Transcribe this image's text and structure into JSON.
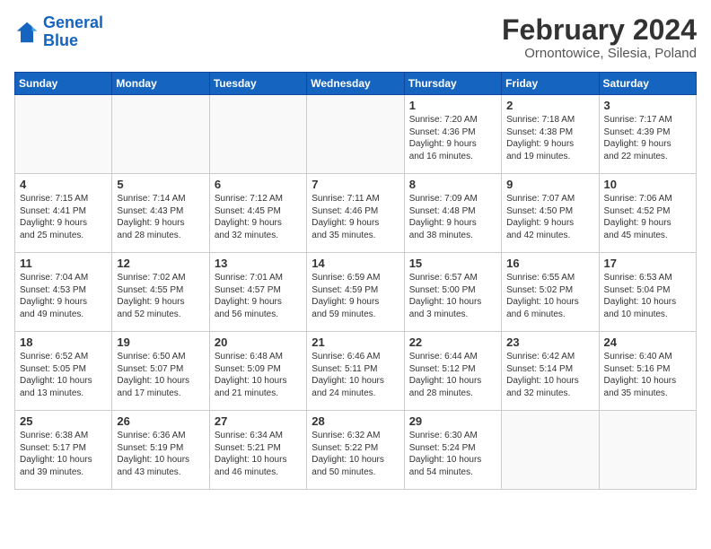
{
  "logo": {
    "line1": "General",
    "line2": "Blue"
  },
  "title": "February 2024",
  "subtitle": "Ornontowice, Silesia, Poland",
  "days_of_week": [
    "Sunday",
    "Monday",
    "Tuesday",
    "Wednesday",
    "Thursday",
    "Friday",
    "Saturday"
  ],
  "weeks": [
    [
      {
        "day": "",
        "info": ""
      },
      {
        "day": "",
        "info": ""
      },
      {
        "day": "",
        "info": ""
      },
      {
        "day": "",
        "info": ""
      },
      {
        "day": "1",
        "info": "Sunrise: 7:20 AM\nSunset: 4:36 PM\nDaylight: 9 hours\nand 16 minutes."
      },
      {
        "day": "2",
        "info": "Sunrise: 7:18 AM\nSunset: 4:38 PM\nDaylight: 9 hours\nand 19 minutes."
      },
      {
        "day": "3",
        "info": "Sunrise: 7:17 AM\nSunset: 4:39 PM\nDaylight: 9 hours\nand 22 minutes."
      }
    ],
    [
      {
        "day": "4",
        "info": "Sunrise: 7:15 AM\nSunset: 4:41 PM\nDaylight: 9 hours\nand 25 minutes."
      },
      {
        "day": "5",
        "info": "Sunrise: 7:14 AM\nSunset: 4:43 PM\nDaylight: 9 hours\nand 28 minutes."
      },
      {
        "day": "6",
        "info": "Sunrise: 7:12 AM\nSunset: 4:45 PM\nDaylight: 9 hours\nand 32 minutes."
      },
      {
        "day": "7",
        "info": "Sunrise: 7:11 AM\nSunset: 4:46 PM\nDaylight: 9 hours\nand 35 minutes."
      },
      {
        "day": "8",
        "info": "Sunrise: 7:09 AM\nSunset: 4:48 PM\nDaylight: 9 hours\nand 38 minutes."
      },
      {
        "day": "9",
        "info": "Sunrise: 7:07 AM\nSunset: 4:50 PM\nDaylight: 9 hours\nand 42 minutes."
      },
      {
        "day": "10",
        "info": "Sunrise: 7:06 AM\nSunset: 4:52 PM\nDaylight: 9 hours\nand 45 minutes."
      }
    ],
    [
      {
        "day": "11",
        "info": "Sunrise: 7:04 AM\nSunset: 4:53 PM\nDaylight: 9 hours\nand 49 minutes."
      },
      {
        "day": "12",
        "info": "Sunrise: 7:02 AM\nSunset: 4:55 PM\nDaylight: 9 hours\nand 52 minutes."
      },
      {
        "day": "13",
        "info": "Sunrise: 7:01 AM\nSunset: 4:57 PM\nDaylight: 9 hours\nand 56 minutes."
      },
      {
        "day": "14",
        "info": "Sunrise: 6:59 AM\nSunset: 4:59 PM\nDaylight: 9 hours\nand 59 minutes."
      },
      {
        "day": "15",
        "info": "Sunrise: 6:57 AM\nSunset: 5:00 PM\nDaylight: 10 hours\nand 3 minutes."
      },
      {
        "day": "16",
        "info": "Sunrise: 6:55 AM\nSunset: 5:02 PM\nDaylight: 10 hours\nand 6 minutes."
      },
      {
        "day": "17",
        "info": "Sunrise: 6:53 AM\nSunset: 5:04 PM\nDaylight: 10 hours\nand 10 minutes."
      }
    ],
    [
      {
        "day": "18",
        "info": "Sunrise: 6:52 AM\nSunset: 5:05 PM\nDaylight: 10 hours\nand 13 minutes."
      },
      {
        "day": "19",
        "info": "Sunrise: 6:50 AM\nSunset: 5:07 PM\nDaylight: 10 hours\nand 17 minutes."
      },
      {
        "day": "20",
        "info": "Sunrise: 6:48 AM\nSunset: 5:09 PM\nDaylight: 10 hours\nand 21 minutes."
      },
      {
        "day": "21",
        "info": "Sunrise: 6:46 AM\nSunset: 5:11 PM\nDaylight: 10 hours\nand 24 minutes."
      },
      {
        "day": "22",
        "info": "Sunrise: 6:44 AM\nSunset: 5:12 PM\nDaylight: 10 hours\nand 28 minutes."
      },
      {
        "day": "23",
        "info": "Sunrise: 6:42 AM\nSunset: 5:14 PM\nDaylight: 10 hours\nand 32 minutes."
      },
      {
        "day": "24",
        "info": "Sunrise: 6:40 AM\nSunset: 5:16 PM\nDaylight: 10 hours\nand 35 minutes."
      }
    ],
    [
      {
        "day": "25",
        "info": "Sunrise: 6:38 AM\nSunset: 5:17 PM\nDaylight: 10 hours\nand 39 minutes."
      },
      {
        "day": "26",
        "info": "Sunrise: 6:36 AM\nSunset: 5:19 PM\nDaylight: 10 hours\nand 43 minutes."
      },
      {
        "day": "27",
        "info": "Sunrise: 6:34 AM\nSunset: 5:21 PM\nDaylight: 10 hours\nand 46 minutes."
      },
      {
        "day": "28",
        "info": "Sunrise: 6:32 AM\nSunset: 5:22 PM\nDaylight: 10 hours\nand 50 minutes."
      },
      {
        "day": "29",
        "info": "Sunrise: 6:30 AM\nSunset: 5:24 PM\nDaylight: 10 hours\nand 54 minutes."
      },
      {
        "day": "",
        "info": ""
      },
      {
        "day": "",
        "info": ""
      }
    ]
  ]
}
